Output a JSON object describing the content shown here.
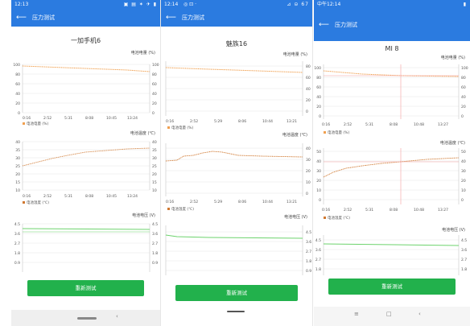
{
  "phones": [
    {
      "status_time": "12:13",
      "status_icons": "▣ ▤ ✶ ✈ ▮",
      "title": "压力测试",
      "device": "一加手机6",
      "button": "重新测试",
      "charts": [
        {
          "label": "电池电量 (%)",
          "legend": "电池电量 (%)",
          "color": "#f0a050",
          "yticks": [
            "100",
            "80",
            "60",
            "40",
            "20",
            "0"
          ],
          "xticks": [
            "0:16",
            "2:52",
            "5:31",
            "8:08",
            "10:45",
            "13:24"
          ]
        },
        {
          "label": "电池温度 (℃)",
          "legend": "电池温度 (℃)",
          "color": "#d07830",
          "yticks": [
            "40",
            "35",
            "30",
            "25",
            "20",
            "15",
            "10"
          ],
          "xticks": [
            "0:16",
            "2:52",
            "5:31",
            "8:08",
            "10:45",
            "13:24"
          ]
        },
        {
          "label": "电池电压 (V)",
          "legend": "",
          "color": "#6dd36d",
          "yticks": [
            "4.5",
            "3.6",
            "2.7",
            "1.8",
            "0.9"
          ],
          "xticks": []
        }
      ]
    },
    {
      "status_time": "12:14",
      "status_icons": "◎ ⊡ ·",
      "status_right": "⊿ ⊝ 67",
      "title": "压力测试",
      "device": "魅族16",
      "button": "重新测试",
      "charts": [
        {
          "label": "电池电量 (%)",
          "legend": "电池电量 (%)",
          "color": "#f0a050",
          "yticks": [
            "80",
            "60",
            "40",
            "20",
            "0"
          ],
          "xticks": [
            "0:16",
            "2:52",
            "5:29",
            "8:06",
            "10:44",
            "13:21"
          ]
        },
        {
          "label": "电池温度 (℃)",
          "legend": "电池温度 (℃)",
          "color": "#d07830",
          "yticks": [
            "40",
            "30",
            "20",
            "10",
            "0"
          ],
          "xticks": [
            "0:16",
            "2:52",
            "5:29",
            "8:06",
            "10:44",
            "13:21"
          ]
        },
        {
          "label": "电池电压 (V)",
          "legend": "",
          "color": "#6dd36d",
          "yticks": [
            "4.5",
            "3.6",
            "2.7",
            "1.8",
            "0.9"
          ],
          "xticks": []
        }
      ]
    },
    {
      "status_time": "中午12:14",
      "status_icons": "▮",
      "title": "压力测试",
      "device": "MI 8",
      "button": "重新测试",
      "charts": [
        {
          "label": "电池电量 (%)",
          "legend": "电池电量 (%)",
          "color": "#f0a050",
          "yticks": [
            "100",
            "80",
            "60",
            "40",
            "20",
            "0"
          ],
          "xticks": [
            "0:16",
            "2:52",
            "5:31",
            "8:08",
            "10:48",
            "13:27"
          ]
        },
        {
          "label": "电池温度 (℃)",
          "legend": "电池温度 (℃)",
          "color": "#d07830",
          "yticks": [
            "50",
            "40",
            "30",
            "20",
            "10",
            "0"
          ],
          "xticks": [
            "0:16",
            "2:52",
            "5:31",
            "8:08",
            "10:48",
            "13:27"
          ]
        },
        {
          "label": "电池电压 (V)",
          "legend": "",
          "color": "#6dd36d",
          "yticks": [
            "4.5",
            "3.6",
            "2.7",
            "1.8",
            "0.9"
          ],
          "xticks": []
        }
      ]
    }
  ]
}
